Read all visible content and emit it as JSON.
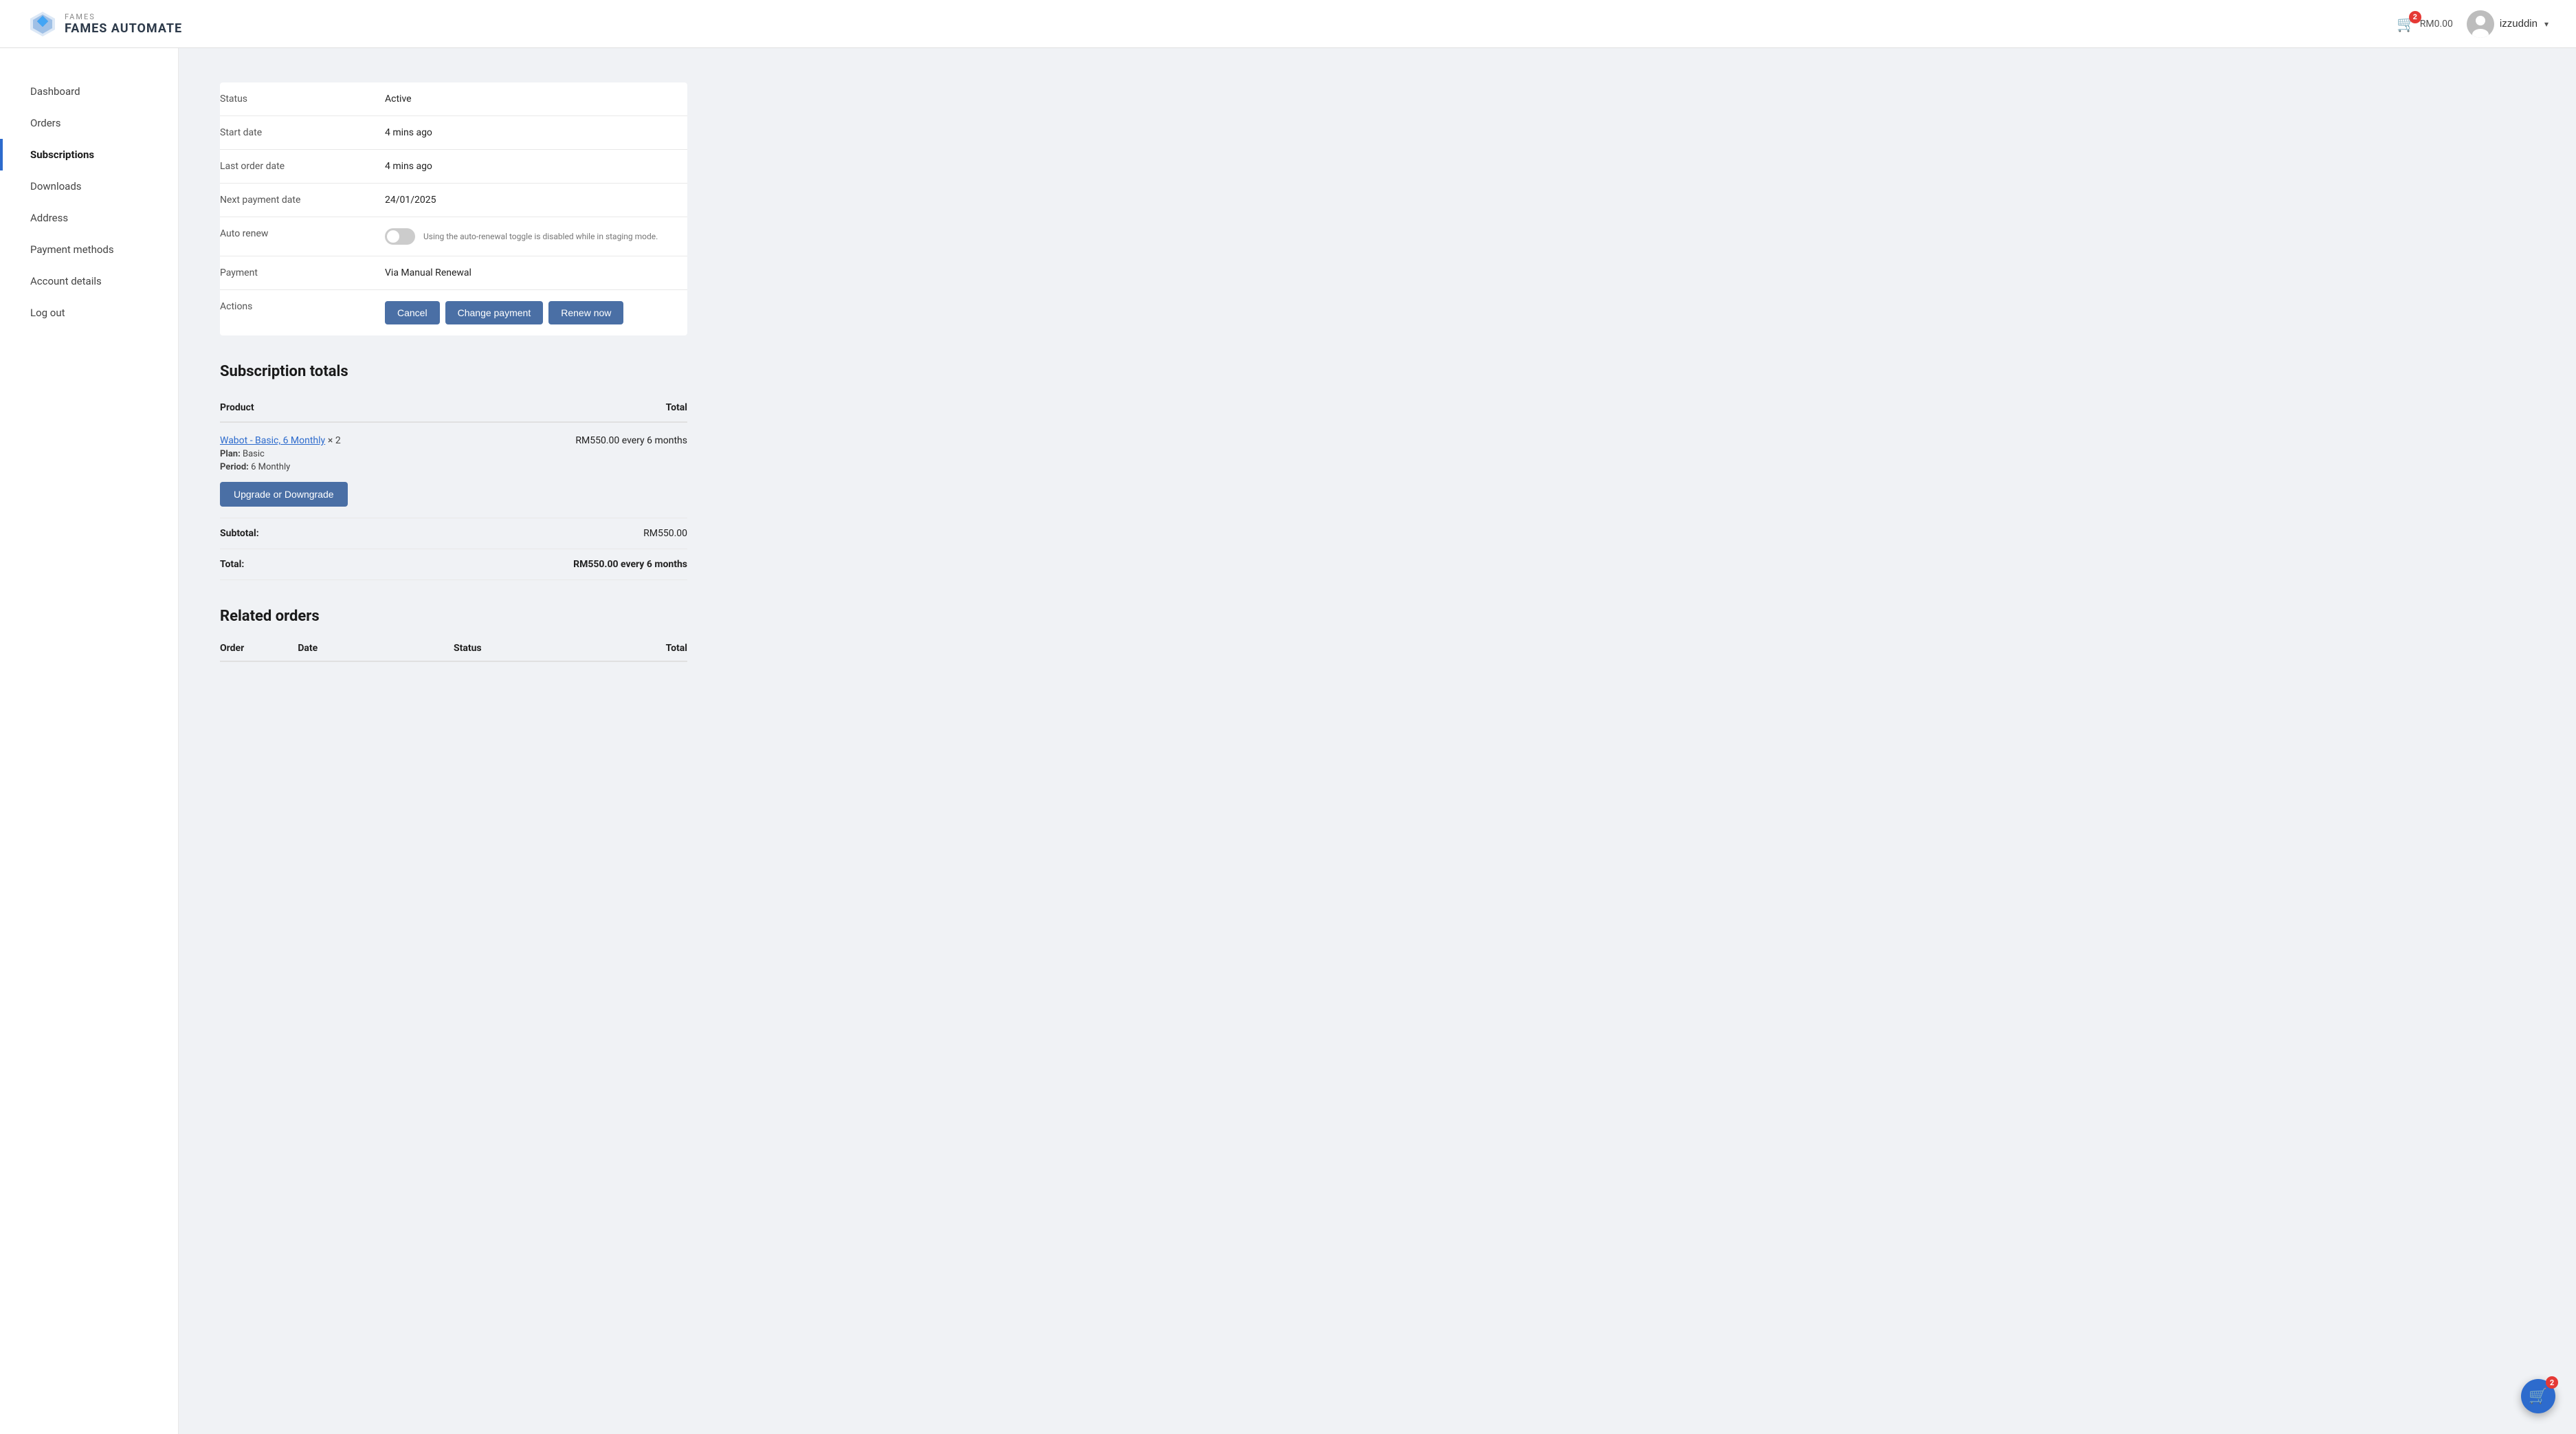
{
  "header": {
    "logo_text": "FAMES AUTOMATE",
    "cart_amount": "RM0.00",
    "cart_badge": "2",
    "username": "izzuddin",
    "floating_cart_badge": "2"
  },
  "sidebar": {
    "items": [
      {
        "id": "dashboard",
        "label": "Dashboard",
        "active": false
      },
      {
        "id": "orders",
        "label": "Orders",
        "active": false
      },
      {
        "id": "subscriptions",
        "label": "Subscriptions",
        "active": true
      },
      {
        "id": "downloads",
        "label": "Downloads",
        "active": false
      },
      {
        "id": "address",
        "label": "Address",
        "active": false
      },
      {
        "id": "payment-methods",
        "label": "Payment methods",
        "active": false
      },
      {
        "id": "account-details",
        "label": "Account details",
        "active": false
      },
      {
        "id": "log-out",
        "label": "Log out",
        "active": false
      }
    ]
  },
  "subscription_details": {
    "rows": [
      {
        "label": "Status",
        "value": "Active"
      },
      {
        "label": "Start date",
        "value": "4 mins ago"
      },
      {
        "label": "Last order date",
        "value": "4 mins ago"
      },
      {
        "label": "Next payment date",
        "value": "24/01/2025"
      },
      {
        "label": "Auto renew",
        "value": "toggle"
      },
      {
        "label": "Payment",
        "value": "Via Manual Renewal"
      },
      {
        "label": "Actions",
        "value": "buttons"
      }
    ],
    "toggle_note": "Using the auto-renewal toggle is disabled while in staging mode.",
    "buttons": {
      "cancel": "Cancel",
      "change_payment": "Change payment",
      "renew_now": "Renew now"
    }
  },
  "subscription_totals": {
    "title": "Subscription totals",
    "columns": {
      "product": "Product",
      "total": "Total"
    },
    "product": {
      "name": "Wabot - Basic, 6 Monthly",
      "quantity": "× 2",
      "plan_label": "Plan:",
      "plan_value": "Basic",
      "period_label": "Period:",
      "period_value": "6 Monthly",
      "total": "RM550.00 every 6 months",
      "upgrade_btn": "Upgrade or Downgrade"
    },
    "subtotal": {
      "label": "Subtotal:",
      "value": "RM550.00"
    },
    "total": {
      "label": "Total:",
      "value": "RM550.00 every 6 months"
    }
  },
  "related_orders": {
    "title": "Related orders",
    "columns": {
      "order": "Order",
      "date": "Date",
      "status": "Status",
      "total": "Total"
    }
  }
}
